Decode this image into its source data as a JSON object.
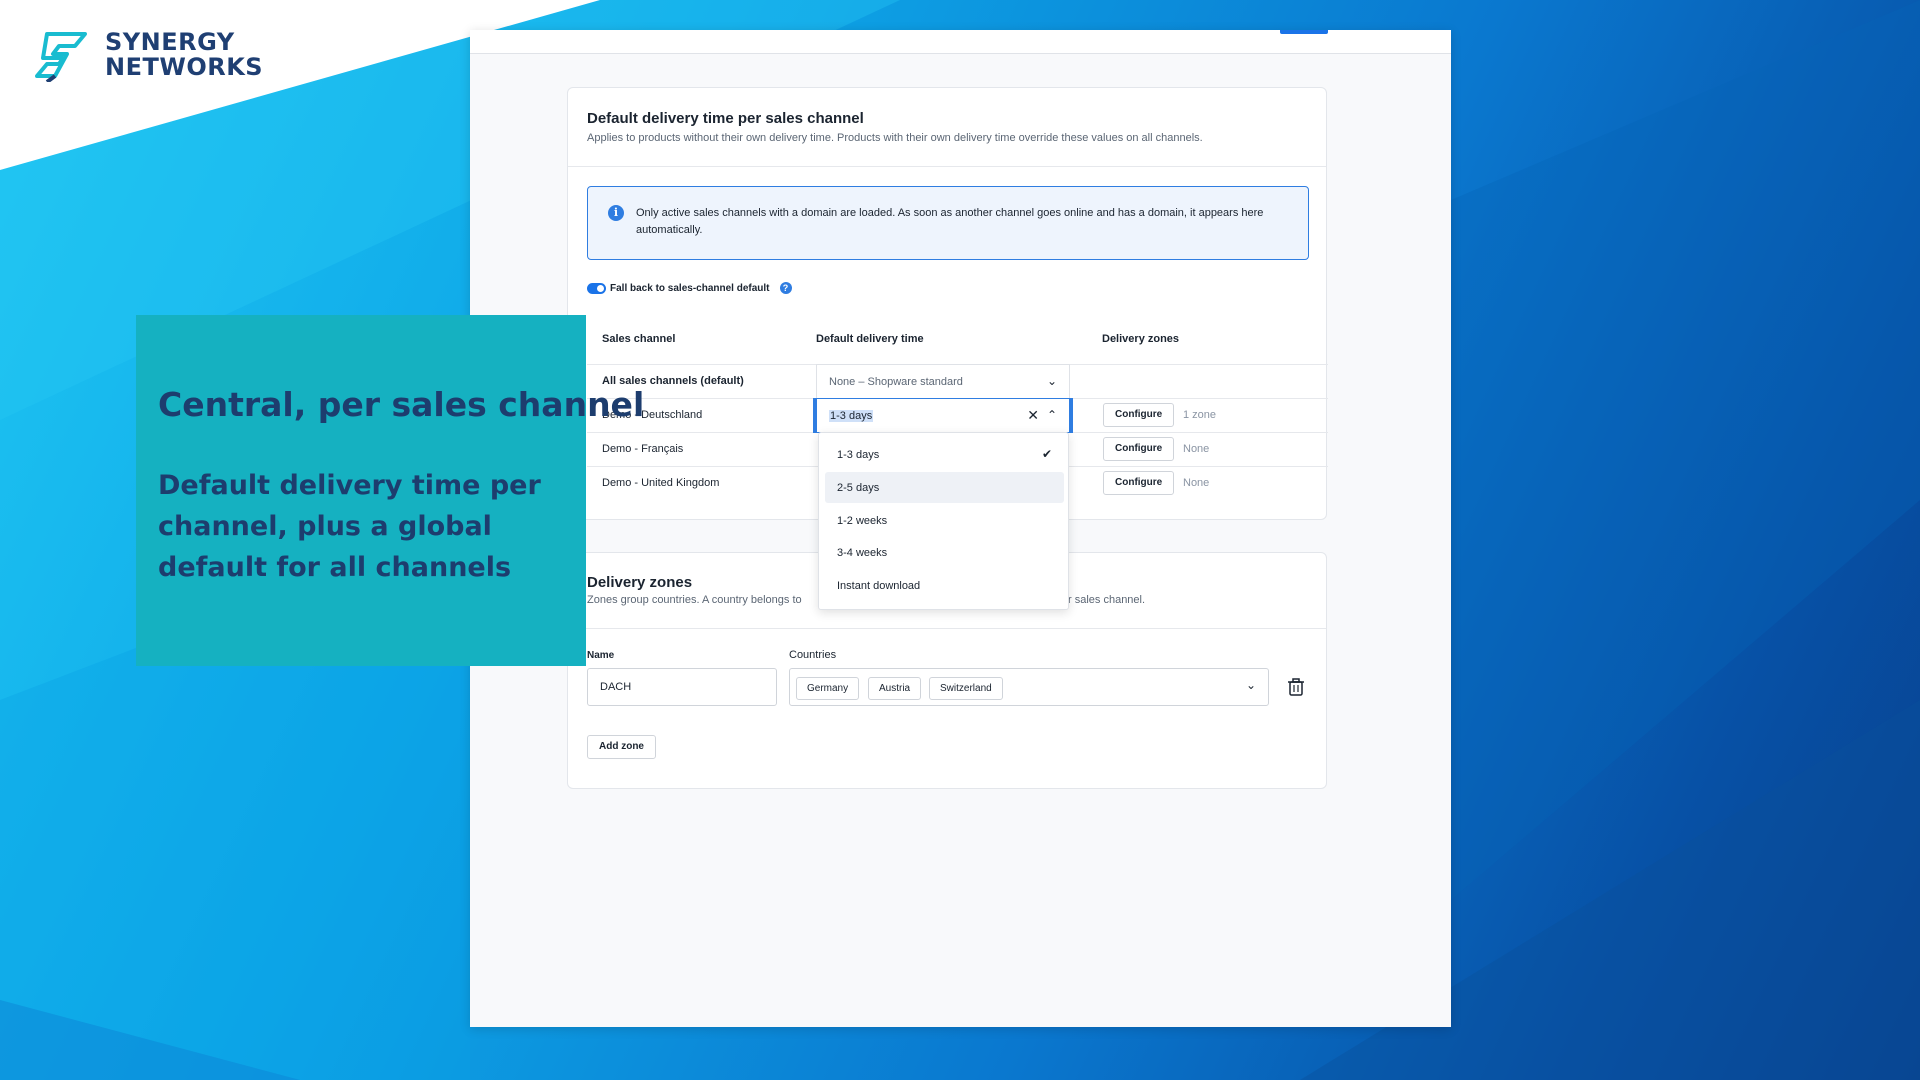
{
  "brand": {
    "line1": "SYNERGY",
    "line2": "NETWORKS",
    "logo_icon": "synergy-logo-icon",
    "colors": {
      "text": "#1f3f73",
      "accent": "#19bcd0"
    }
  },
  "overlay": {
    "title": "Central, per sales channel",
    "text": "Default delivery time per channel, plus a global default for all channels",
    "bg_color": "#15b1c1"
  },
  "card1": {
    "title": "Default delivery time per sales channel",
    "subtitle": "Applies to products without their own delivery time. Products with their own delivery time override these values on all channels.",
    "info": {
      "icon": "info-icon",
      "text": "Only active sales channels with a domain are loaded. As soon as another channel goes online and has a domain, it appears here automatically."
    },
    "toggle": {
      "label": "Fall back to sales-channel default",
      "on": true,
      "help_icon": "help-icon"
    },
    "columns": [
      "Sales channel",
      "Default delivery time",
      "Delivery zones"
    ],
    "rows": [
      {
        "channel": "All sales channels (default)",
        "delivery_time": "None – Shopware standard",
        "configure": "",
        "zones": ""
      },
      {
        "channel": "Demo - Deutschland",
        "delivery_time": "1-3 days",
        "configure": "Configure",
        "zones": "1 zone"
      },
      {
        "channel": "Demo - Français",
        "delivery_time": "",
        "configure": "Configure",
        "zones": "None"
      },
      {
        "channel": "Demo - United Kingdom",
        "delivery_time": "",
        "configure": "Configure",
        "zones": "None"
      }
    ],
    "dropdown": {
      "options": [
        "1-3 days",
        "2-5 days",
        "1-2 weeks",
        "3-4 weeks",
        "Instant download"
      ],
      "selected": "1-3 days",
      "hovered": "2-5 days"
    }
  },
  "card2": {
    "title": "Delivery zones",
    "subtitle_left": "Zones group countries. A country belongs to",
    "subtitle_right": "r sales channel.",
    "name_label": "Name",
    "countries_label": "Countries",
    "name_value": "DACH",
    "countries": [
      "Germany",
      "Austria",
      "Switzerland"
    ],
    "add_zone": "Add zone",
    "delete_icon": "trash-icon"
  }
}
